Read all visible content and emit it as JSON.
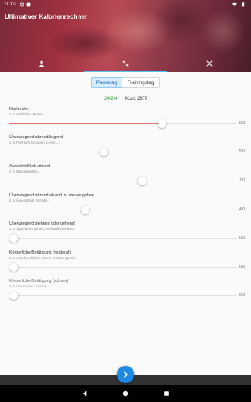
{
  "status_bar": {
    "time": "10:02",
    "icons": [
      "settings-icon",
      "notification-icon",
      "wifi-icon",
      "battery-icon"
    ]
  },
  "app": {
    "title": "Ultimativer Kalorienrechner"
  },
  "tabs": [
    {
      "icon": "person-icon",
      "active": false
    },
    {
      "icon": "resize-icon",
      "active": true
    },
    {
      "icon": "cutlery-icon",
      "active": false
    }
  ],
  "segment": {
    "options": [
      "Pausetag",
      "Trainingstag"
    ],
    "selected": "Pausetag"
  },
  "summary": {
    "hours": "24/24h",
    "kcal": "Kcal: 2878"
  },
  "activities": [
    {
      "label": "Nachtruhe",
      "hint": "z.B. Schlafen, Ruhen...",
      "value": "8.0",
      "fraction": 0.67
    },
    {
      "label": "Überwiegend sitzend/liegend",
      "hint": "z.B. Fernseh schauen, Lesen...",
      "value": "5.0",
      "fraction": 0.417
    },
    {
      "label": "Ausschließlich sitzend",
      "hint": "z.B. Büroarbeiten...",
      "value": "7.0",
      "fraction": 0.583
    },
    {
      "label": "Überwiegend sitzend,ab und zu stehen/gehen",
      "hint": "z.B. Hausarbeit, Schule...",
      "value": "4.0",
      "fraction": 0.333
    },
    {
      "label": "Überwiegend stehend oder gehend",
      "hint": "z.B. Spazieren gehen, Verkäufer,Kellner...",
      "value": "0.0",
      "fraction": 0.0
    },
    {
      "label": "Körperliche Betätigung (moderat)",
      "hint": "z.B. Handwerkliche Arbeit, leichter Sport...",
      "value": "0.0",
      "fraction": 0.0
    },
    {
      "label": "Körperliche Betätigung (schwer)",
      "hint": "z.B. Intensives Training...",
      "value": "0.0",
      "fraction": 0.0
    }
  ],
  "fab": {
    "icon": "chevron-right-icon"
  },
  "nav": {
    "icons": [
      "back-icon",
      "home-icon",
      "recents-icon"
    ]
  },
  "colors": {
    "accent": "#1e88e5",
    "slider_fill": "#e57373",
    "tab_indicator": "#4fc3f7",
    "hours_ok": "#2e9e3e"
  }
}
